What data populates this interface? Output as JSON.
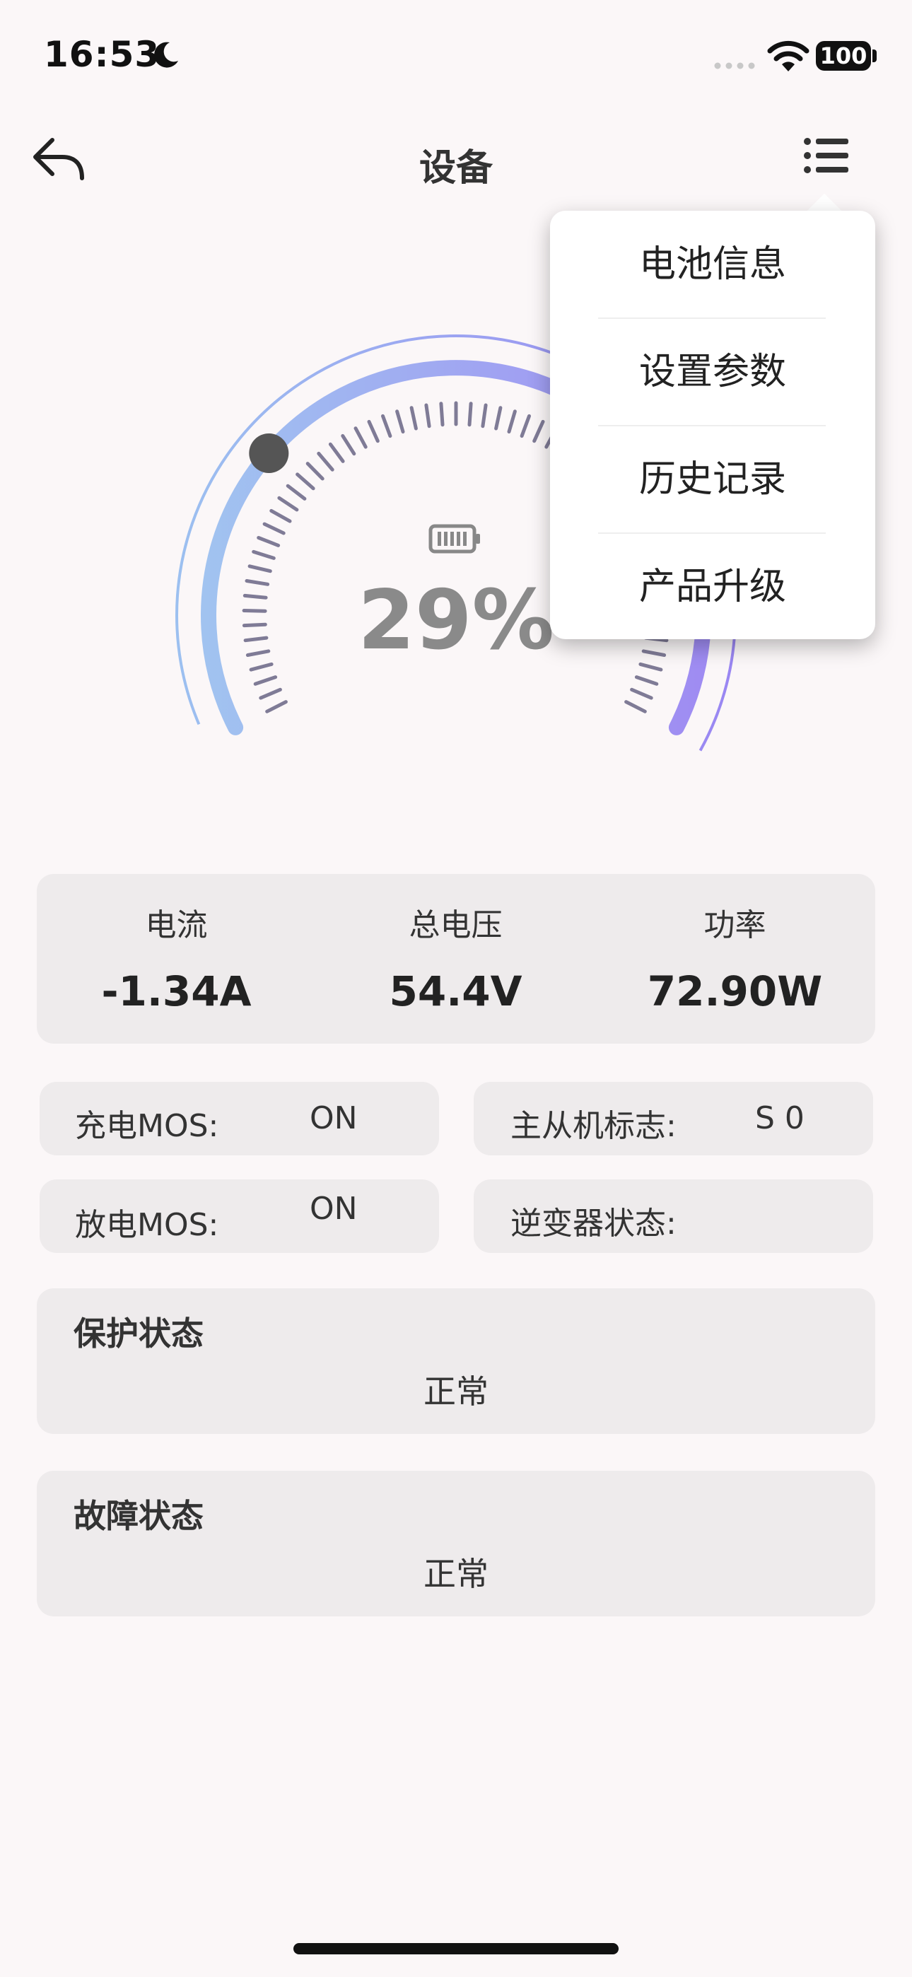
{
  "status_bar": {
    "time": "16:53",
    "battery": "100"
  },
  "header": {
    "title": "设备"
  },
  "gauge": {
    "percent_text": "29%",
    "level_fraction": 0.29
  },
  "dropdown": {
    "items": [
      {
        "label": "电池信息"
      },
      {
        "label": "设置参数"
      },
      {
        "label": "历史记录"
      },
      {
        "label": "产品升级"
      }
    ]
  },
  "metrics": [
    {
      "label": "电流",
      "value": "-1.34A"
    },
    {
      "label": "总电压",
      "value": "54.4V"
    },
    {
      "label": "功率",
      "value": "72.90W"
    }
  ],
  "status": {
    "charge_mos": {
      "label": "充电MOS:",
      "value": "ON"
    },
    "master_slave": {
      "label": "主从机标志:",
      "value": "S 0"
    },
    "discharge_mos": {
      "label": "放电MOS:",
      "value": "ON"
    },
    "inverter": {
      "label": "逆变器状态:",
      "value": ""
    }
  },
  "protection": {
    "title": "保护状态",
    "value": "正常"
  },
  "fault": {
    "title": "故障状态",
    "value": "正常"
  },
  "colors": {
    "arc_start": "#9CC0F0",
    "arc_end": "#9A86F2",
    "tick": "#7F7B96",
    "card": "#EEEBEC",
    "background": "#FBF7F8"
  }
}
